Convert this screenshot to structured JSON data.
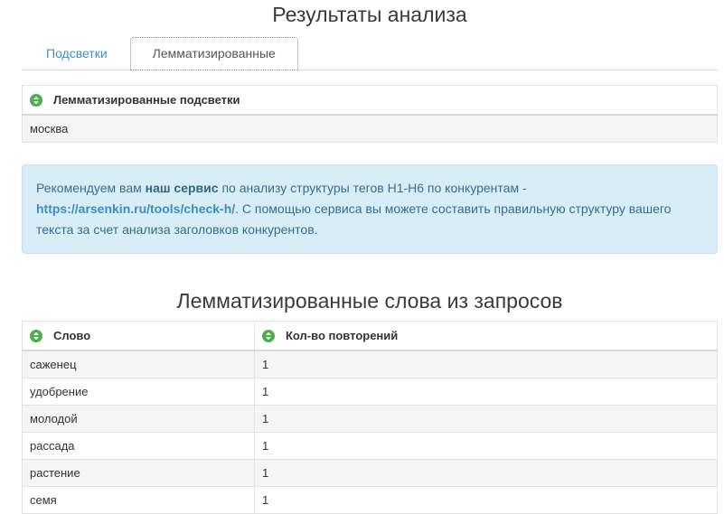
{
  "page": {
    "title": "Результаты анализа"
  },
  "tabs": [
    {
      "label": "Подсветки",
      "active": false
    },
    {
      "label": "Лемматизированные",
      "active": true
    }
  ],
  "highlights_table": {
    "header": "Лемматизированные подсветки",
    "rows": [
      "москва"
    ]
  },
  "info_box": {
    "text_before": "Рекомендуем вам ",
    "link_service": "наш сервис",
    "text_mid": " по анализу структуры тегов H1-H6 по конкурентам - ",
    "link_url": "https://arsenkin.ru/tools/check-h/",
    "text_after": ". С помощью сервиса вы можете составить правильную структуру вашего текста за счет анализа заголовков конкурентов."
  },
  "words_section": {
    "title": "Лемматизированные слова из запросов",
    "columns": [
      "Слово",
      "Кол-во повторений"
    ],
    "rows": [
      [
        "саженец",
        "1"
      ],
      [
        "удобрение",
        "1"
      ],
      [
        "молодой",
        "1"
      ],
      [
        "рассада",
        "1"
      ],
      [
        "растение",
        "1"
      ],
      [
        "семя",
        "1"
      ]
    ]
  },
  "icons": {
    "sort": "sort-toggle-icon"
  },
  "colors": {
    "accent_green": "#4cae4c",
    "link_blue": "#4190c6",
    "info_bg": "#d9edf7",
    "info_text": "#31708f"
  }
}
